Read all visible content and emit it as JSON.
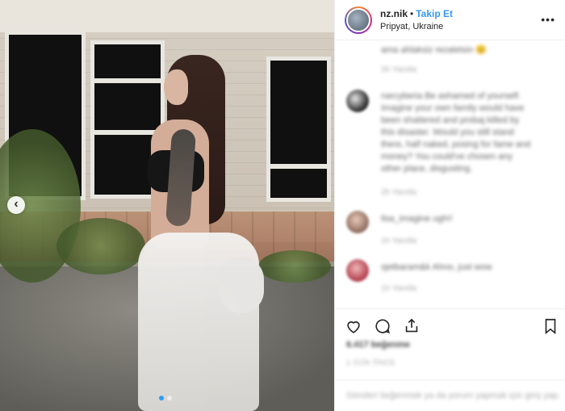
{
  "post": {
    "username": "nz.nik",
    "separator": "•",
    "follow_label": "Takip Et",
    "location": "Pripyat, Ukraine",
    "more_glyph": "•••",
    "carousel": {
      "slides": 2,
      "active_index": 0
    },
    "prev_arrow_glyph": "‹"
  },
  "comments": [
    {
      "lines": [
        "ama ahlaksiz rezaletsin 😊"
      ],
      "meta": "2h  Yanıtla"
    },
    {
      "lines": [
        "narcyberia Be ashamed of yourself.",
        "Imagine your own family would have",
        "been shattered and probaj killed by",
        "this disaster. Would you still stand",
        "there, half naked, posing for fame and",
        "money? You could've chosen any",
        "other place, disgusting."
      ],
      "meta": "2h  Yanıtla"
    },
    {
      "lines": [
        "lisa_imagine ugh!!"
      ],
      "meta": "1h  Yanıtla"
    },
    {
      "lines": [
        "sjetbaram&k Ahno, just wow"
      ],
      "meta": "1h  Yanıtla"
    }
  ],
  "footer": {
    "likes": "6.417 beğenme",
    "posted": "1 GÜN ÖNCE",
    "add_comment_placeholder": "Gönderi beğenmek ya da yorum yapmak için giriş yap."
  },
  "colors": {
    "follow": "#3897f0",
    "active_dot": "#2f9bf5"
  }
}
